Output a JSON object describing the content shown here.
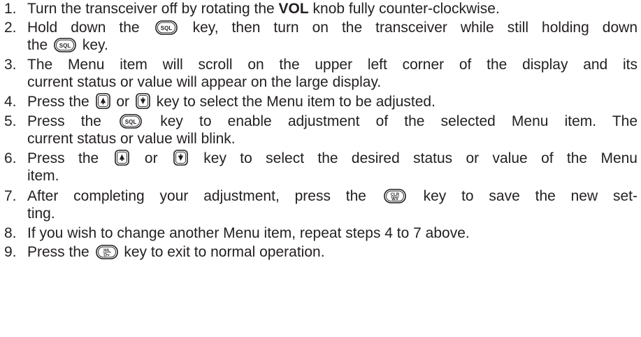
{
  "steps": [
    {
      "n": "1.",
      "lines": [
        [
          {
            "t": "text",
            "v": "Turn the transceiver off by rotating the "
          },
          {
            "t": "bold",
            "v": "VOL"
          },
          {
            "t": "text",
            "v": " knob fully counter-clockwise."
          }
        ]
      ]
    },
    {
      "n": "2.",
      "lines": [
        [
          {
            "t": "text",
            "v": "Hold down the "
          },
          {
            "t": "key",
            "k": "sql-key",
            "v": "SQL"
          },
          {
            "t": "text",
            "v": " key, then turn on the transceiver while still holding down"
          }
        ],
        [
          {
            "t": "text",
            "v": "the "
          },
          {
            "t": "key",
            "k": "sql-key",
            "v": "SQL"
          },
          {
            "t": "text",
            "v": " key."
          }
        ]
      ]
    },
    {
      "n": "3.",
      "lines": [
        [
          {
            "t": "text",
            "v": "The Menu item will scroll on the upper left corner of the display and its"
          }
        ],
        [
          {
            "t": "text",
            "v": "current status or value will appear on the large display."
          }
        ]
      ]
    },
    {
      "n": "4.",
      "lines": [
        [
          {
            "t": "text",
            "v": "Press the "
          },
          {
            "t": "key",
            "k": "up-key",
            "v": ""
          },
          {
            "t": "text",
            "v": " or "
          },
          {
            "t": "key",
            "k": "down-key",
            "v": ""
          },
          {
            "t": "text",
            "v": " key to select the Menu item to be adjusted."
          }
        ]
      ]
    },
    {
      "n": "5.",
      "lines": [
        [
          {
            "t": "text",
            "v": "Press the "
          },
          {
            "t": "key",
            "k": "sql-key",
            "v": "SQL"
          },
          {
            "t": "text",
            "v": " key to enable adjustment of the selected Menu item. The"
          }
        ],
        [
          {
            "t": "text",
            "v": "current status or value will blink."
          }
        ]
      ]
    },
    {
      "n": "6.",
      "lines": [
        [
          {
            "t": "text",
            "v": "Press the "
          },
          {
            "t": "key",
            "k": "up-key",
            "v": ""
          },
          {
            "t": "text",
            "v": " or "
          },
          {
            "t": "key",
            "k": "down-key",
            "v": ""
          },
          {
            "t": "text",
            "v": " key to select the desired status or value of the Menu"
          }
        ],
        [
          {
            "t": "text",
            "v": "item."
          }
        ]
      ]
    },
    {
      "n": "7.",
      "lines": [
        [
          {
            "t": "text",
            "v": "After completing your adjustment, press the "
          },
          {
            "t": "key",
            "k": "clr-wx-key",
            "v": "CLR/WX"
          },
          {
            "t": "text",
            "v": " key to save the new set-"
          }
        ],
        [
          {
            "t": "text",
            "v": "ting."
          }
        ]
      ]
    },
    {
      "n": "8.",
      "lines": [
        [
          {
            "t": "text",
            "v": "If you wish to change another Menu item, repeat steps 4 to 7 above."
          }
        ]
      ]
    },
    {
      "n": "9.",
      "lines": [
        [
          {
            "t": "text",
            "v": "Press the "
          },
          {
            "t": "key",
            "k": "hl-lock-key",
            "v": "H/L"
          },
          {
            "t": "text",
            "v": " key to exit to normal operation."
          }
        ]
      ]
    }
  ]
}
